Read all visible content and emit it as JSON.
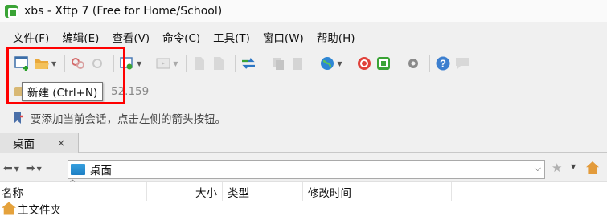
{
  "window": {
    "title": "xbs - Xftp 7 (Free for Home/School)"
  },
  "menu": {
    "items": [
      "文件(F)",
      "编辑(E)",
      "查看(V)",
      "命令(C)",
      "工具(T)",
      "窗口(W)",
      "帮助(H)"
    ]
  },
  "toolbar": {
    "icons": [
      "new-session-icon",
      "open-folder-icon",
      "disconnect-icon",
      "reconnect-icon",
      "properties-icon",
      "terminal-icon",
      "copy-icon",
      "paste-icon",
      "transfer-icon",
      "globe-icon",
      "xshell-icon",
      "xftp-icon",
      "settings-icon",
      "help-icon",
      "chat-icon"
    ]
  },
  "tooltip": {
    "text": "新建 (Ctrl+N)"
  },
  "address": {
    "partial_ip": "52.159"
  },
  "hint": {
    "text": "要添加当前会话，点击左侧的箭头按钮。"
  },
  "tabs": [
    {
      "label": "桌面",
      "close": "×"
    }
  ],
  "path": {
    "value": "桌面"
  },
  "columns": {
    "name": "名称",
    "size": "大小",
    "type": "类型",
    "mtime": "修改时间"
  },
  "rows": [
    {
      "name": "主文件夹"
    }
  ],
  "colors": {
    "highlight": "#ff0000",
    "app_green": "#3aa335",
    "folder_blue": "#1e7fc4"
  }
}
